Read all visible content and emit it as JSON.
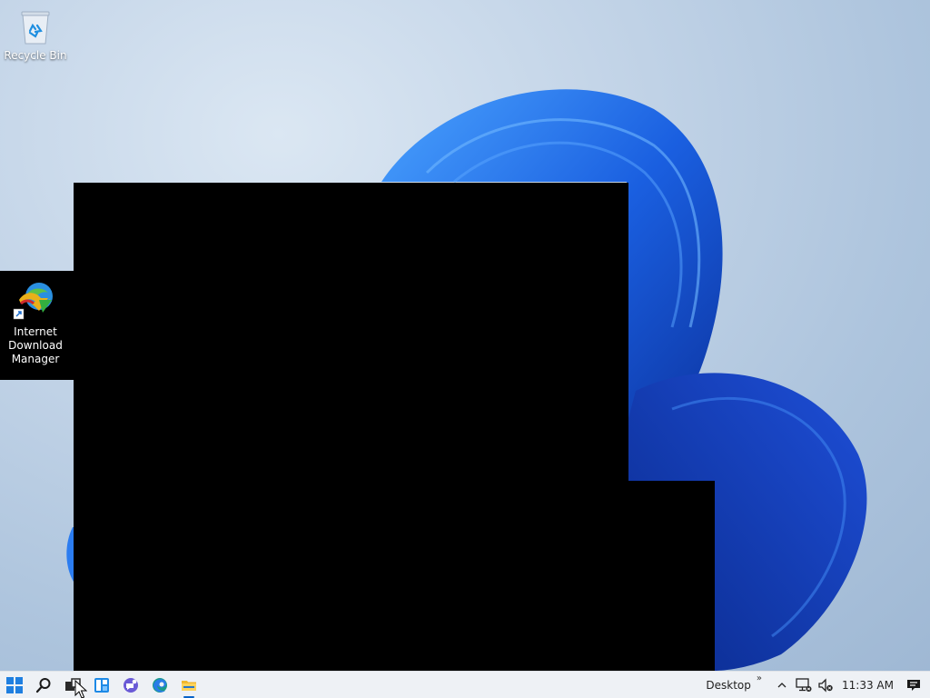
{
  "desktop": {
    "icons": [
      {
        "label": "Recycle Bin",
        "icon": "recycle-bin-icon"
      },
      {
        "label": "Internet Download Manager",
        "label_lines": [
          "Internet",
          "Download",
          "Manager"
        ],
        "icon": "idm-icon"
      }
    ]
  },
  "taskbar": {
    "pinned": [
      {
        "name": "start",
        "icon": "windows-logo-icon"
      },
      {
        "name": "search",
        "icon": "search-icon"
      },
      {
        "name": "task-view",
        "icon": "task-view-icon"
      },
      {
        "name": "widgets",
        "icon": "widgets-icon"
      },
      {
        "name": "chat",
        "icon": "chat-icon"
      },
      {
        "name": "edge",
        "icon": "edge-icon"
      },
      {
        "name": "file-explorer",
        "icon": "file-explorer-icon"
      }
    ],
    "toolbar_label": "Desktop",
    "toolbar_chevron": "»",
    "tray": {
      "overflow_icon": "chevron-up-icon",
      "network_icon": "network-icon",
      "volume_icon": "volume-muted-icon",
      "time": "11:33 AM",
      "notification_icon": "notification-icon"
    }
  },
  "colors": {
    "accent": "#0a64c8",
    "taskbar_bg": "#eef1f5"
  }
}
